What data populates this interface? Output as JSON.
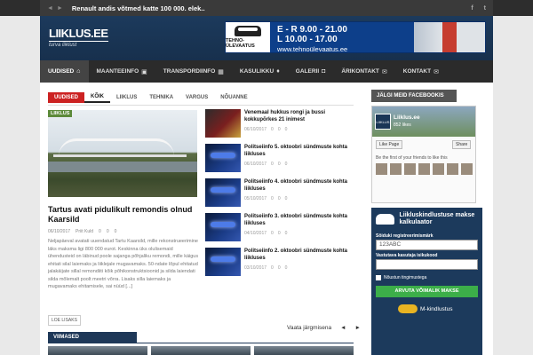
{
  "topbar": {
    "ticker_prev": "◄",
    "ticker_next": "►",
    "ticker_text": "Renault andis võtmed katte 100 000. elek..",
    "social_facebook": "f",
    "social_twitter": "t"
  },
  "header": {
    "logo_name": "LIIKLUS.EE",
    "logo_slogan": "turva liiklust",
    "banner_brand": "TEHNO-ÜLEVAATUS",
    "banner_hours_weekday": "E - R   9.00 - 21.00",
    "banner_hours_saturday": "L   10.00 - 17.00",
    "banner_url": "www.tehnoülevaatus.ee"
  },
  "nav": {
    "items": [
      {
        "label": "UUDISED",
        "icon": "home-icon",
        "glyph": "⌂"
      },
      {
        "label": "MAANTEEINFO",
        "icon": "sign-icon",
        "glyph": "▣"
      },
      {
        "label": "TRANSPORDIINFO",
        "icon": "bus-icon",
        "glyph": "▦"
      },
      {
        "label": "KASULIKKU",
        "icon": "thumb-icon",
        "glyph": "♦"
      },
      {
        "label": "GALERII",
        "icon": "camera-icon",
        "glyph": "◘"
      },
      {
        "label": "ÄRIKONTAKT",
        "icon": "mail-icon",
        "glyph": "✉"
      },
      {
        "label": "KONTAKT",
        "icon": "mail-icon",
        "glyph": "✉"
      }
    ]
  },
  "tabs": [
    "UUDISED",
    "KÕIK",
    "LIIKLUS",
    "TEHNIKA",
    "VARGUS",
    "NÕUANNE"
  ],
  "featured": {
    "category": "LIIKLUS",
    "title": "Tartus avati pidulikult remondis olnud Kaarsild",
    "date": "06/10/2017",
    "author": "Priit Kuld",
    "count1": "0",
    "count2": "0",
    "count3": "0",
    "body": "Neljapäeval avatati uuendatud Tartu Kaarsild, mille rekonstrueerimine läks maksma ligi 800 000 eurot. Keskinna üks olulisemaid ühendusteid on läbinud poole sajanga põhjaliku remondi, mille käigus ehitati silal laiemaks ja liiklejale mugavamaks. 50-ndate lõpul ehitatud jalakäijate sillal remondiiti kõik põhikonstruktsioonid ja silda laiendati silda mõlemalt poolt meetri võrra. Lisaks silla laiemaks ja mugavamaks ehitamisele, sai nüüd [...]",
    "read_more": "LOE LISAKS"
  },
  "news": [
    {
      "title": "Venemaal hukkus rongi ja bussi kokkupõrkes 21 inimest",
      "date": "06/10/2017",
      "c1": "0",
      "c2": "0",
      "c3": "0",
      "thumb": "bus"
    },
    {
      "title": "Politseiinfo 5. oktoobri sündmuste kohta liikluses",
      "date": "06/10/2017",
      "c1": "0",
      "c2": "0",
      "c3": "0",
      "thumb": "police"
    },
    {
      "title": "Politseiinfo 4. oktoobri sündmuste kohta liikluses",
      "date": "05/10/2017",
      "c1": "0",
      "c2": "0",
      "c3": "0",
      "thumb": "police"
    },
    {
      "title": "Politseiinfo 3. oktoobri sündmuste kohta liikluses",
      "date": "04/10/2017",
      "c1": "0",
      "c2": "0",
      "c3": "0",
      "thumb": "police"
    },
    {
      "title": "Politseiinfo 2. oktoobri sündmuste kohta liikluses",
      "date": "03/10/2017",
      "c1": "0",
      "c2": "0",
      "c3": "0",
      "thumb": "police"
    }
  ],
  "pager": {
    "label": "Vaata järgmisena",
    "prev": "◄",
    "next": "►"
  },
  "viimased": "VIIMASED",
  "sidebar": {
    "fb_head": "JÄLGI MEID FACEBOOKIS",
    "fb_page_name": "Liiklus.ee",
    "fb_likes": "852 likes",
    "fb_like": "Like Page",
    "fb_share": "Share",
    "fb_friends": "Be the first of your friends to like this"
  },
  "insurance": {
    "title": "Liikluskindlustuse makse kalkulaator",
    "reg_label": "Sõiduki registreerimismärk",
    "reg_value": "123ABC",
    "id_label": "Vastutava kasutaja isikukood",
    "terms": "Nõustun tingimustega",
    "submit": "ARVUTA VÕIMALIK MAKSE",
    "provider": "M-kindlustus"
  }
}
